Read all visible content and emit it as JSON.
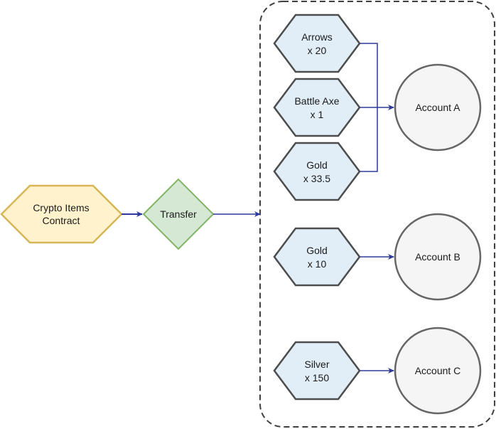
{
  "colors": {
    "contract_fill": "#fff2cc",
    "contract_stroke": "#d6b656",
    "transfer_fill": "#d5e8d4",
    "transfer_stroke": "#82b366",
    "item_fill": "#e1eef7",
    "item_stroke": "#4d4d4d",
    "account_fill": "#f5f5f5",
    "account_stroke": "#666666",
    "edge": "#2b3a9c",
    "container_stroke": "#404040"
  },
  "contract": {
    "line1": "Crypto Items",
    "line2": "Contract"
  },
  "transfer": {
    "label": "Transfer"
  },
  "items": [
    {
      "name": "Arrows",
      "qty": "x 20",
      "to": "Account A"
    },
    {
      "name": "Battle Axe",
      "qty": "x 1",
      "to": "Account A"
    },
    {
      "name": "Gold",
      "qty": "x 33.5",
      "to": "Account A"
    },
    {
      "name": "Gold",
      "qty": "x 10",
      "to": "Account B"
    },
    {
      "name": "Silver",
      "qty": "x 150",
      "to": "Account C"
    }
  ],
  "accounts": [
    {
      "label": "Account A"
    },
    {
      "label": "Account B"
    },
    {
      "label": "Account C"
    }
  ]
}
